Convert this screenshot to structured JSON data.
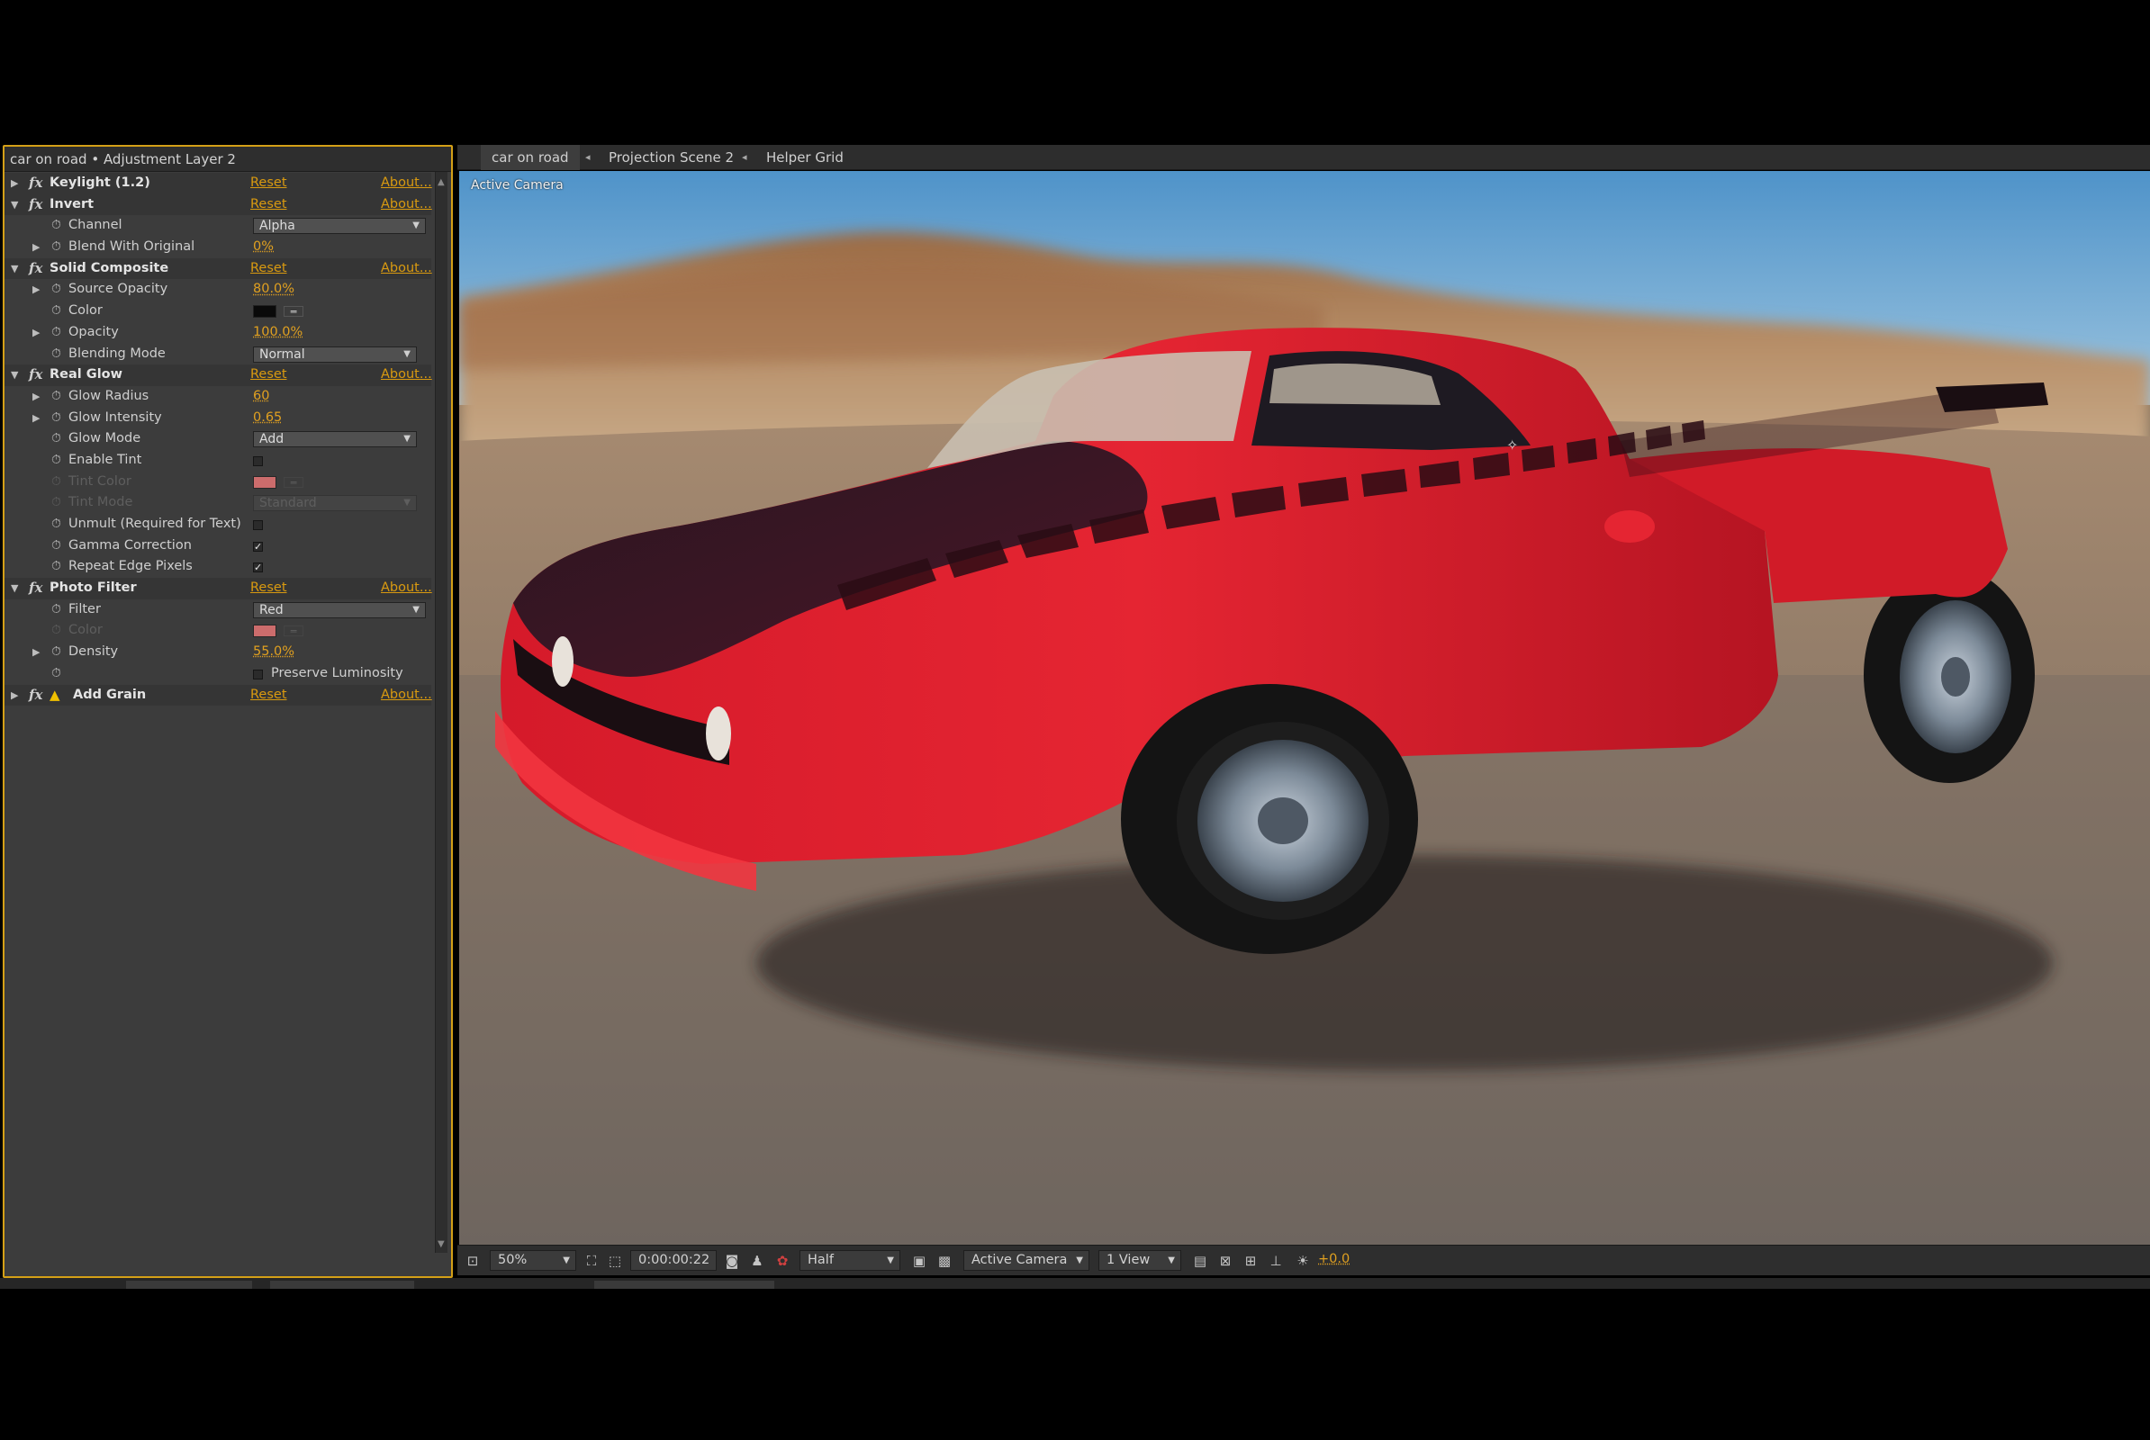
{
  "fx_panel": {
    "title": "car on road • Adjustment Layer 2",
    "rows": [
      {
        "kind": "effect",
        "name": "Keylight (1.2)",
        "expanded": false,
        "reset": "Reset",
        "about": "About..."
      },
      {
        "kind": "effect",
        "name": "Invert",
        "expanded": true,
        "reset": "Reset",
        "about": "About..."
      },
      {
        "kind": "prop",
        "name": "Channel",
        "control": "dropdown",
        "value": "Alpha"
      },
      {
        "kind": "prop",
        "name": "Blend With Original",
        "expandable": true,
        "control": "value",
        "value": "0%"
      },
      {
        "kind": "effect",
        "name": "Solid Composite",
        "expanded": true,
        "reset": "Reset",
        "about": "About..."
      },
      {
        "kind": "prop",
        "name": "Source Opacity",
        "expandable": true,
        "control": "value",
        "value": "80.0%"
      },
      {
        "kind": "prop",
        "name": "Color",
        "control": "color",
        "value": "#0a0a0a"
      },
      {
        "kind": "prop",
        "name": "Opacity",
        "expandable": true,
        "control": "value",
        "value": "100.0%"
      },
      {
        "kind": "prop",
        "name": "Blending Mode",
        "control": "dropdown2",
        "value": "Normal"
      },
      {
        "kind": "effect",
        "name": "Real Glow",
        "expanded": true,
        "reset": "Reset",
        "about": "About..."
      },
      {
        "kind": "prop",
        "name": "Glow Radius",
        "expandable": true,
        "control": "value",
        "value": "60"
      },
      {
        "kind": "prop",
        "name": "Glow Intensity",
        "expandable": true,
        "control": "value",
        "value": "0.65"
      },
      {
        "kind": "prop",
        "name": "Glow Mode",
        "control": "dropdown2",
        "value": "Add"
      },
      {
        "kind": "prop",
        "name": "Enable Tint",
        "control": "checkbox",
        "checked": false
      },
      {
        "kind": "prop",
        "name": "Tint Color",
        "disabled": true,
        "control": "color",
        "value": "#f07878"
      },
      {
        "kind": "prop",
        "name": "Tint Mode",
        "disabled": true,
        "control": "dropdown2",
        "value": "Standard"
      },
      {
        "kind": "prop",
        "name": "Unmult (Required for Text)",
        "control": "checkbox",
        "checked": false
      },
      {
        "kind": "prop",
        "name": "Gamma Correction",
        "control": "checkbox",
        "checked": true
      },
      {
        "kind": "prop",
        "name": "Repeat Edge Pixels",
        "control": "checkbox",
        "checked": true
      },
      {
        "kind": "effect",
        "name": "Photo Filter",
        "expanded": true,
        "reset": "Reset",
        "about": "About..."
      },
      {
        "kind": "prop",
        "name": "Filter",
        "control": "dropdown",
        "value": "Red"
      },
      {
        "kind": "prop",
        "name": "Color",
        "disabled": true,
        "control": "color",
        "value": "#f07878"
      },
      {
        "kind": "prop",
        "name": "Density",
        "expandable": true,
        "control": "value",
        "value": "55.0%"
      },
      {
        "kind": "prop",
        "name": "",
        "control": "checkbox-label",
        "checked": false,
        "label": "Preserve Luminosity"
      },
      {
        "kind": "effect",
        "name": "Add Grain",
        "expanded": false,
        "warning": true,
        "reset": "Reset",
        "about": "About..."
      }
    ]
  },
  "viewer": {
    "tabs": [
      "car on road",
      "Projection Scene 2",
      "Helper Grid"
    ],
    "camera_label": "Active Camera",
    "toolbar": {
      "zoom": "50%",
      "timecode": "0:00:00:22",
      "resolution": "Half",
      "camera": "Active Camera",
      "views": "1 View",
      "exposure": "+0.0"
    }
  },
  "colors": {
    "accent": "#d99a10",
    "panel_border": "#d4a017",
    "car_red": "#e01f2c"
  },
  "icons": {
    "effect_prefix": "fx",
    "warning": "warning-icon",
    "stopwatch": "stopwatch-icon"
  }
}
